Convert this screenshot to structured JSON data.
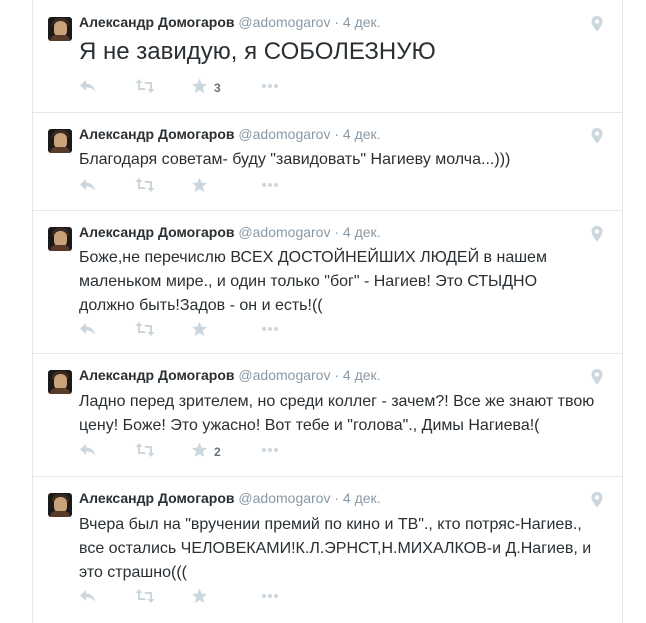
{
  "tweets": [
    {
      "fullname": "Александр Домогаров",
      "username": "@adomogarov",
      "separator": "·",
      "time": "4 дек.",
      "text": "Я не завидую, я СОБОЛЕЗНУЮ",
      "favorite_count": "3",
      "retweet_count": ""
    },
    {
      "fullname": "Александр Домогаров",
      "username": "@adomogarov",
      "separator": "·",
      "time": "4 дек.",
      "text": "Благодаря советам- буду \"завидовать\"  Нагиеву молча...)))",
      "favorite_count": "",
      "retweet_count": ""
    },
    {
      "fullname": "Александр Домогаров",
      "username": "@adomogarov",
      "separator": "·",
      "time": "4 дек.",
      "text_lines": [
        "Боже,не перечислю ВСЕХ ДОСТОЙНЕЙШИХ ЛЮДЕЙ в нашем",
        "маленьком мире., и один только \"бог\" - Нагиев! Это СТЫДНО",
        "должно быть!Задов - он и есть!(("
      ],
      "favorite_count": "",
      "retweet_count": ""
    },
    {
      "fullname": "Александр Домогаров",
      "username": "@adomogarov",
      "separator": "·",
      "time": "4 дек.",
      "text_lines": [
        "Ладно перед зрителем, но среди коллег - зачем?! Все же знают твою",
        "цену! Боже! Это ужасно! Вот тебе и \"голова\"., Димы Нагиева!("
      ],
      "favorite_count": "2",
      "retweet_count": ""
    },
    {
      "fullname": "Александр Домогаров",
      "username": "@adomogarov",
      "separator": "·",
      "time": "4 дек.",
      "text_lines": [
        "Вчера был на \"вручении премий по кино и ТВ\"., кто потряс-Нагиев.,",
        "все остались ЧЕЛОВЕКАМИ!К.Л.ЭРНСТ,Н.МИХАЛКОВ-и Д.Нагиев, и",
        "это страшно((("
      ],
      "favorite_count": "",
      "retweet_count": ""
    }
  ],
  "colors": {
    "text": "#292f33",
    "muted": "#8899a6",
    "icon": "#ccd6dd",
    "border": "#e1e8ed"
  },
  "icons": {
    "reply": "reply-icon",
    "retweet": "retweet-icon",
    "favorite": "star-icon",
    "more": "more-dots-icon",
    "geo": "location-pin-icon"
  }
}
